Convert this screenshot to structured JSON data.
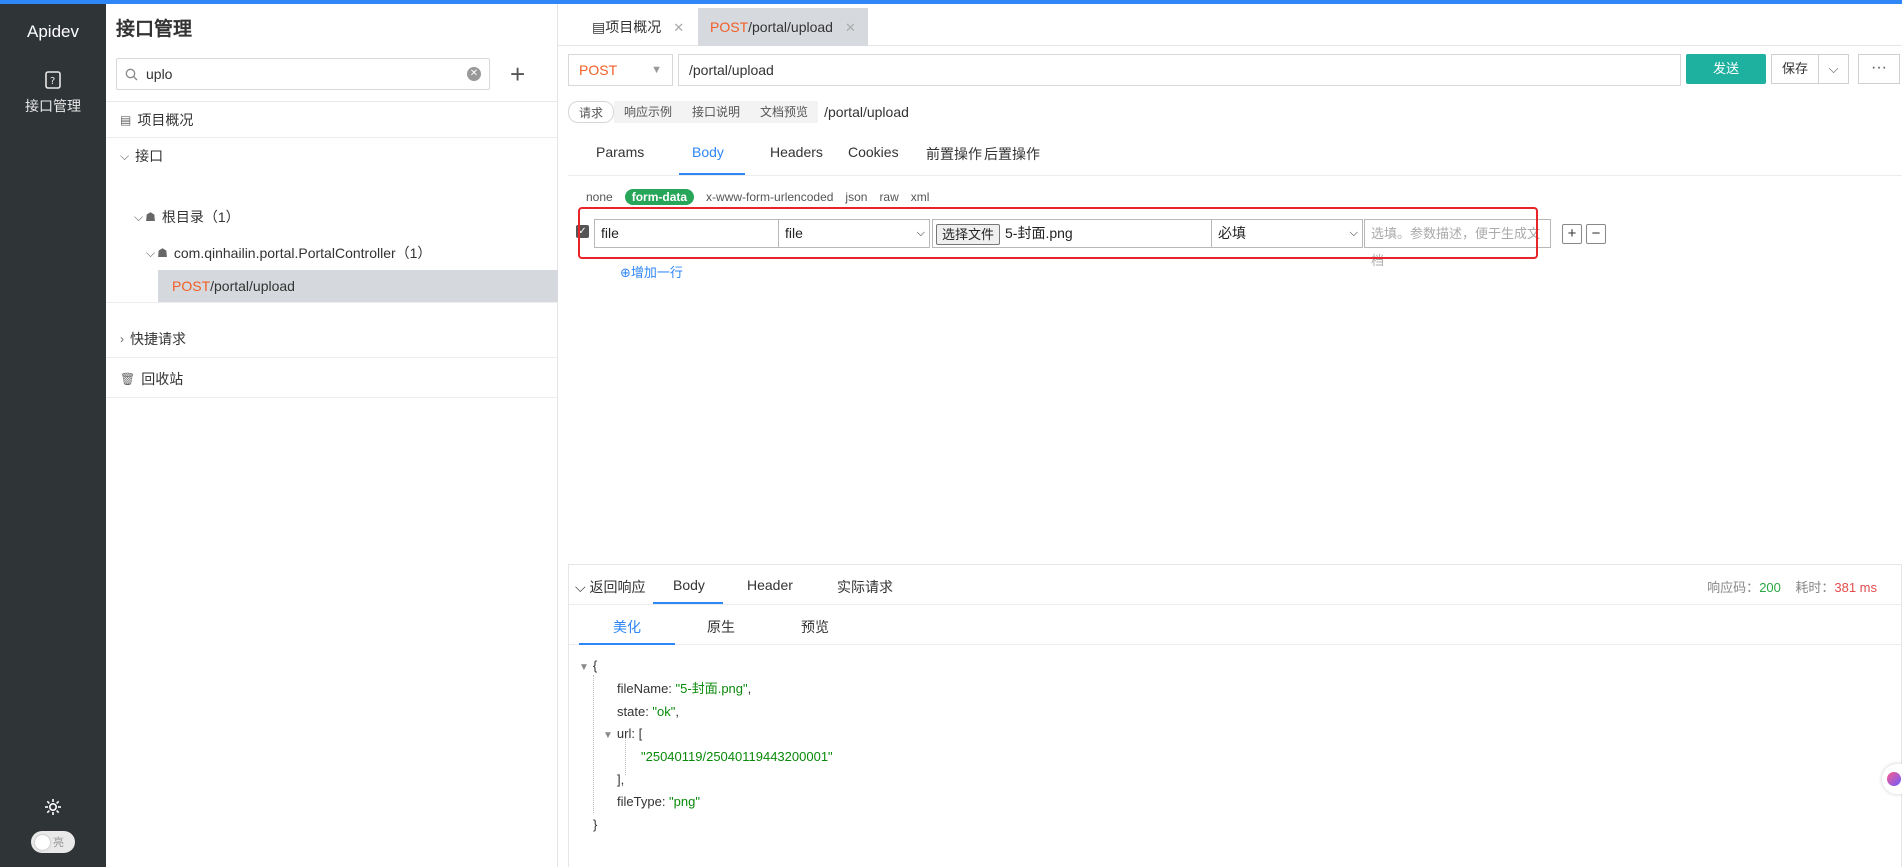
{
  "rail": {
    "brand": "Apidev",
    "nav_label": "接口管理",
    "theme_toggle_label": "亮"
  },
  "sidebar": {
    "title": "接口管理",
    "search_value": "uplo",
    "tree": {
      "overview": "项目概况",
      "api_group": "接口",
      "root": "根目录（1）",
      "controller": "com.qinhailin.portal.PortalController（1）",
      "endpoint_method": "POST",
      "endpoint_path": "/portal/upload",
      "quick_request": "快捷请求",
      "recycle_bin": "回收站"
    }
  },
  "tabs": [
    {
      "label": "项目概况"
    },
    {
      "method": "POST",
      "label": "/portal/upload"
    }
  ],
  "request": {
    "method": "POST",
    "url": "/portal/upload",
    "send": "发送",
    "save": "保存",
    "more": "···"
  },
  "subtabs": [
    "请求",
    "响应示例",
    "接口说明",
    "文档预览"
  ],
  "subtab_path": "/portal/upload",
  "param_tabs": [
    "Params",
    "Body",
    "Headers",
    "Cookies",
    "前置操作",
    "后置操作"
  ],
  "body_types": [
    "none",
    "form-data",
    "x-www-form-urlencoded",
    "json",
    "raw",
    "xml"
  ],
  "form_row": {
    "name": "file",
    "type": "file",
    "file_button": "选择文件",
    "file_name": "5-封面.png",
    "required": "必填",
    "desc_placeholder": "选填。参数描述，便于生成文档",
    "add_row": "增加一行"
  },
  "response": {
    "toggle": "返回响应",
    "tabs": [
      "Body",
      "Header",
      "实际请求"
    ],
    "status_label": "响应码：",
    "status_code": "200",
    "time_label": "耗时：",
    "time_value": "381 ms",
    "views": [
      "美化",
      "原生",
      "预览"
    ],
    "json": {
      "open": "{",
      "k1": "fileName",
      "v1": "\"5-封面.png\"",
      "k2": "state",
      "v2": "\"ok\"",
      "k3": "url",
      "arr_open": "[",
      "arr_v": "\"25040119/25040119443200001\"",
      "arr_close": "],",
      "k4": "fileType",
      "v4": "\"png\"",
      "close": "}"
    }
  },
  "colors": {
    "accent": "#2f86f6",
    "send": "#1fb1a0",
    "post": "#f25e26",
    "highlight_box": "#e8242a",
    "form_data_badge": "#27a559"
  }
}
